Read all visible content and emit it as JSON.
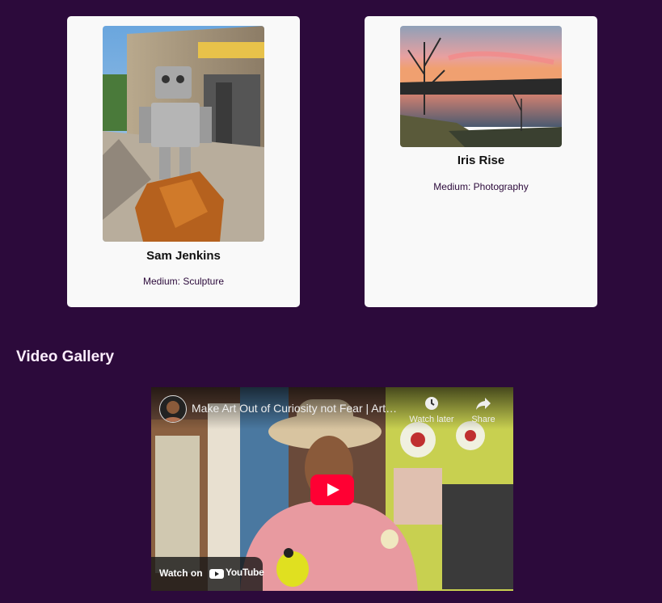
{
  "artists": [
    {
      "name": "Sam Jenkins",
      "medium": "Medium: Sculpture",
      "artwork_subject": "robot-sculpture-image"
    },
    {
      "name": "Iris Rise",
      "medium": "Medium: Photography",
      "artwork_subject": "sunset-lake-image"
    }
  ],
  "video_section": {
    "title": "Video Gallery"
  },
  "video": {
    "title": "Make Art Out of Curiosity not Fear | Art ...",
    "watch_later": "Watch later",
    "share": "Share",
    "watch_on": "Watch on",
    "youtube": "YouTube"
  },
  "colors": {
    "background": "#2c0a3b",
    "card": "#f9f9f9",
    "youtube_red": "#ff0000"
  }
}
